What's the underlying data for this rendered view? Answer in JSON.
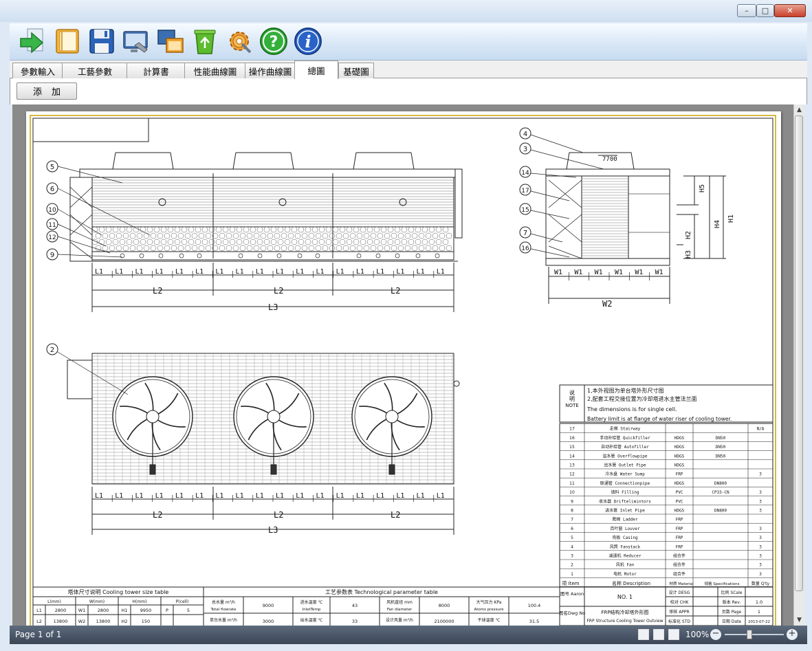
{
  "window": {
    "minimize_glyph": "–",
    "maximize_glyph": "□",
    "close_glyph": "✕"
  },
  "toolbar": {
    "icons": [
      "arrow-right-icon",
      "book-icon",
      "save-icon",
      "settings-monitor-icon",
      "copy-window-icon",
      "recycle-bin-icon",
      "gear-icon",
      "help-icon",
      "info-icon"
    ],
    "help_glyph": "?",
    "info_glyph": "i"
  },
  "tabs": [
    {
      "label": "參數輸入"
    },
    {
      "label": "工藝參數"
    },
    {
      "label": "計算書"
    },
    {
      "label": "性能曲線圖"
    },
    {
      "label": "操作曲線圖"
    },
    {
      "label": "總圖"
    },
    {
      "label": "基礎圖"
    }
  ],
  "active_tab": 5,
  "panel": {
    "add_button": "添加"
  },
  "drawing": {
    "front_cell_dims": [
      "L1",
      "L1",
      "L1",
      "L1",
      "L1",
      "L1",
      "L1",
      "L1",
      "L1",
      "L1",
      "L1",
      "L1",
      "L1",
      "L1",
      "L1",
      "L1",
      "L1",
      "L1"
    ],
    "l2": "L2",
    "l3": "L3",
    "w1": "W1",
    "w2": "W2",
    "dim_7700": "7700",
    "height_labels": [
      "H5",
      "H4",
      "H1",
      "H2",
      "H3"
    ],
    "front_callouts": [
      "5",
      "6",
      "10",
      "11",
      "12",
      "9"
    ],
    "side_callouts": [
      "4",
      "3",
      "14",
      "17",
      "15",
      "7",
      "16"
    ],
    "plan_callout": "2",
    "note_label": [
      "说",
      "明",
      "NOTE"
    ],
    "notes": [
      "1,本外视图为单台塔外形尺寸图",
      "2,配套工程交接位置为冷却塔进水主管法兰面",
      "The dimensions is for single cell.",
      "Battery limit is at flange of water riser of cooling tower."
    ],
    "parts": [
      {
        "no": "17",
        "desc": "走梯 Stairway",
        "mat": "",
        "spec": "",
        "qty": "N/A"
      },
      {
        "no": "16",
        "desc": "手动补给管 Quickfiller",
        "mat": "HDGS",
        "spec": "DN50",
        "qty": ""
      },
      {
        "no": "15",
        "desc": "自动补给管 Autofiller",
        "mat": "HDGS",
        "spec": "DN50",
        "qty": ""
      },
      {
        "no": "14",
        "desc": "溢水管 Overflowpipe",
        "mat": "HDGS",
        "spec": "DN50",
        "qty": ""
      },
      {
        "no": "13",
        "desc": "出水管 Outlet Pipe",
        "mat": "HDGS",
        "spec": "",
        "qty": ""
      },
      {
        "no": "12",
        "desc": "冷水盘 Water Sump",
        "mat": "FRP",
        "spec": "",
        "qty": "3"
      },
      {
        "no": "11",
        "desc": "联通管 Connectionpipe",
        "mat": "HDGS",
        "spec": "DN800",
        "qty": ""
      },
      {
        "no": "10",
        "desc": "填料 Filling",
        "mat": "PVC",
        "spec": "CP33-CN",
        "qty": "3"
      },
      {
        "no": "9",
        "desc": "收水器 Driftelimintors",
        "mat": "PVC",
        "spec": "",
        "qty": "3"
      },
      {
        "no": "8",
        "desc": "进水管 Inlet Pipe",
        "mat": "HDGS",
        "spec": "DN800",
        "qty": "3"
      },
      {
        "no": "7",
        "desc": "爬梯 Ladder",
        "mat": "FRP",
        "spec": "",
        "qty": ""
      },
      {
        "no": "6",
        "desc": "百叶窗 Louver",
        "mat": "FRP",
        "spec": "",
        "qty": "3"
      },
      {
        "no": "5",
        "desc": "壳板 Casing",
        "mat": "FRP",
        "spec": "",
        "qty": "3"
      },
      {
        "no": "4",
        "desc": "风筒 Fanstack",
        "mat": "FRP",
        "spec": "",
        "qty": "3"
      },
      {
        "no": "3",
        "desc": "减速机 Reducer",
        "mat": "组合件",
        "spec": "",
        "qty": "3"
      },
      {
        "no": "2",
        "desc": "风机 Fan",
        "mat": "组合件",
        "spec": "",
        "qty": "3"
      },
      {
        "no": "1",
        "desc": "电机 Motor",
        "mat": "组合件",
        "spec": "",
        "qty": "3"
      }
    ],
    "parts_header": {
      "no": "项 Item",
      "desc": "名称 Description",
      "mat": "材质 Material",
      "spec": "规格 Specifications",
      "qty": "数量 Q'ty"
    },
    "title_block": {
      "drawing_no_label": "图号 Aaron",
      "drawing_no": "NO. 1",
      "drawing_name_label": "图名Dwg No",
      "drawing_name_cn": "FRP结构冷却塔外形图",
      "drawing_name_en": "FRP Structure Cooling Tower Outview",
      "design_label": "设计 DESG",
      "check_label": "校对 CHK",
      "approve_label": "审核 APPR",
      "std_label": "标准化 STD",
      "scale_label": "比例 SCale",
      "rev_label": "版本 Rev.",
      "rev": "1.0",
      "page_label": "页数 Page",
      "page": "1",
      "date_label": "日期 Date",
      "date": "2013-07-22"
    },
    "size_table": {
      "title": "塔体尺寸说明  Cooling tower size table",
      "headers": [
        "L(mm)",
        "W(mm)",
        "H(mm)",
        "P(cell)"
      ],
      "row1": [
        "L1",
        "2800",
        "W1",
        "2800",
        "H1",
        "9950",
        "P",
        "5"
      ],
      "row2": [
        "L2",
        "13800",
        "W2",
        "13800",
        "H2",
        "150",
        "",
        ""
      ]
    },
    "param_table": {
      "title": "工艺参数表  Technological parameter table",
      "row1": [
        {
          "label": "总水量 m³/h",
          "sub": "Total flowrate",
          "value": "9000"
        },
        {
          "label": "进水温度 ℃",
          "sub": "InletTemp",
          "value": "43"
        },
        {
          "label": "风机直径  mm",
          "sub": "Fan diameter",
          "value": "8000"
        },
        {
          "label": "大气压力 KPa",
          "sub": "Atoms pressure",
          "value": "100.4"
        }
      ],
      "row2": [
        {
          "label": "单台水量 m³/h",
          "value": "3000"
        },
        {
          "label": "出水温度 ℃",
          "value": "33"
        },
        {
          "label": "设计风量 m³/h",
          "value": "2100000"
        },
        {
          "label": "干球温度 ℃",
          "value": "31.5"
        }
      ]
    }
  },
  "status": {
    "page": "Page 1 of 1",
    "zoom": "100%",
    "zoom_out_glyph": "−",
    "zoom_in_glyph": "+"
  }
}
